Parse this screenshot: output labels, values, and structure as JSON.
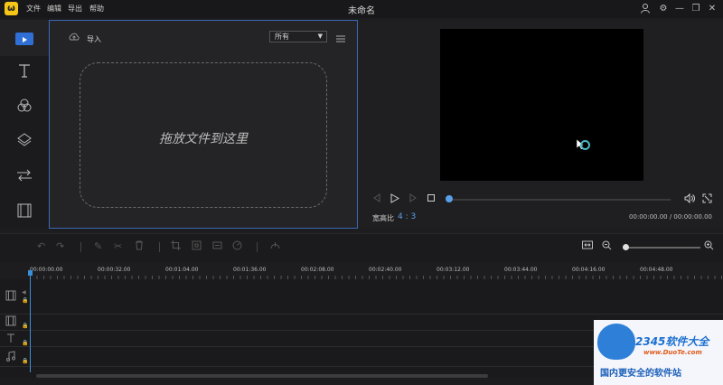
{
  "app": {
    "logo_glyph": "ω",
    "menu": [
      "文件",
      "编辑",
      "导出",
      "帮助"
    ],
    "document_title": "未命名",
    "window_controls": [
      "user-icon",
      "gear-icon",
      "minimize-icon",
      "restore-icon",
      "close-icon"
    ]
  },
  "sidebar": {
    "tools": [
      "media-icon",
      "text-icon",
      "filter-icon",
      "overlay-icon",
      "transition-icon",
      "film-icon"
    ]
  },
  "media_panel": {
    "import_label": "导入",
    "filter_value": "所有",
    "drop_text": "拖放文件到这里"
  },
  "preview": {
    "aspect_label": "宽高比",
    "aspect_value": "4 : 3",
    "current_time": "00:00:00.00",
    "total_time": "00:00:00.00",
    "time_separator": " / ",
    "progress": 0
  },
  "edit_toolbar": {
    "tools": [
      "undo-icon",
      "redo-icon",
      "pen-icon",
      "cut-icon",
      "delete-icon",
      "crop-icon",
      "freeze-icon",
      "resize-icon",
      "speed-icon",
      "voice-icon"
    ],
    "zoom_level": 0.05
  },
  "timeline": {
    "ruler_labels": [
      "00:00:00.00",
      "00:00:32.00",
      "00:01:04.00",
      "00:01:36.00",
      "00:02:08.00",
      "00:02:40.00",
      "00:03:12.00",
      "00:03:44.00",
      "00:04:16.00",
      "00:04:48.00"
    ],
    "tracks": [
      "video-track-icon",
      "pip-track-icon",
      "text-track-icon",
      "music-track-icon"
    ]
  },
  "watermark": {
    "brand": "2345软件大全",
    "url": "www.DuoTe.com",
    "slogan": "国内更安全的软件站"
  },
  "colors": {
    "accent": "#3a8fd8",
    "panel_border": "#3d68b5"
  }
}
